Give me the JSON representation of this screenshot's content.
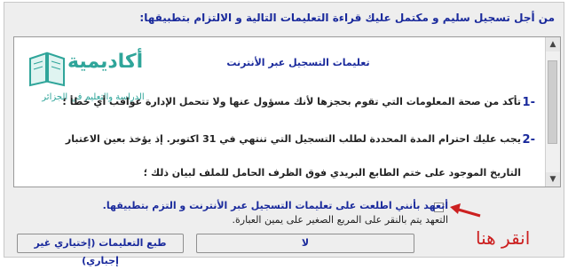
{
  "instruction": "من أجل تسجيل سليم و مكتمل عليك قراءة التعليمات التالية و الالتزام بتطبيقها:",
  "logo": {
    "text": "أكاديمية",
    "subtitle": "الدراسة والتعليم في الجزائر"
  },
  "panel": {
    "title": "تعليمات التسجيل عبر الأنترنت",
    "items": [
      {
        "number": "1-",
        "text": "تأكد من صحة المعلومات التي تقوم بحجزها لأنك مسؤول عنها ولا تتحمل الإدارة عواقب أي خطأ ؛"
      },
      {
        "number": "2-",
        "text": "يجب عليك احترام المدة المحددة لطلب التسجيل التي تنتهي في 31 اكتوبر. إذ يؤخذ بعين الاعتبار"
      },
      {
        "number": "",
        "text": "التاريخ الموجود على ختم الطابع البريدي فوق الظرف الحامل للملف لبيان ذلك ؛"
      }
    ]
  },
  "pledge": {
    "text": "أتعهد بأنني اطلعت على تعليمات التسجيل عبر الأنترنت و التزم بتطبيقها.",
    "note": "التعهد يتم بالنقر على المربع الصغير على يمين العبارة."
  },
  "annotation": "انقر هنا",
  "buttons": {
    "print": "طبع التعليمات (إختياري غير إجباري)",
    "no": "لا"
  }
}
